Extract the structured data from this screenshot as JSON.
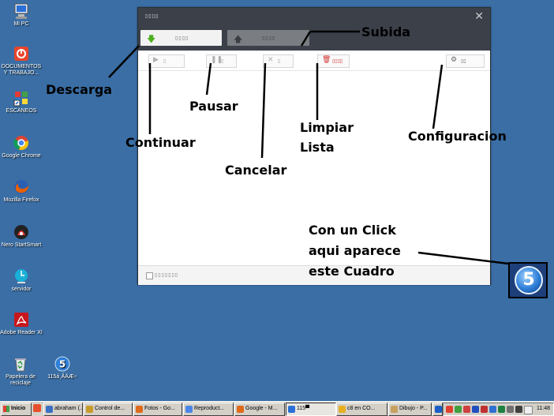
{
  "desktop": {
    "icons": [
      {
        "label": "Mi PC",
        "icon": "my-computer-icon"
      },
      {
        "label": "DOCUMENTOS Y TRABAJO...",
        "icon": "documents-icon"
      },
      {
        "label": "ESCANEOS",
        "icon": "shortcut-icon"
      },
      {
        "label": "Google Chrome",
        "icon": "chrome-icon"
      },
      {
        "label": "Mozilla Firefox",
        "icon": "firefox-icon"
      },
      {
        "label": "Nero StartSmart",
        "icon": "nero-icon"
      },
      {
        "label": "servidor",
        "icon": "server-icon"
      },
      {
        "label": "Adobe Reader XI",
        "icon": "adobe-reader-icon"
      },
      {
        "label": "Papelera de reciclaje",
        "icon": "recycle-bin-icon"
      },
      {
        "label": "115á¸ÂÄÆ÷",
        "icon": "app-115-icon"
      }
    ]
  },
  "app": {
    "title": "▯▯▯▯",
    "close": "✕",
    "tabs": {
      "download": {
        "arrow": "🡇",
        "label": "▯▯▯▯"
      },
      "upload": {
        "arrow": "🡅",
        "label": "▯▯▯▯"
      }
    },
    "toolbar": {
      "continue": {
        "icon": "▶",
        "label": "▯"
      },
      "pause": {
        "icon": "❚❚",
        "label": "▯"
      },
      "cancel": {
        "icon": "✕",
        "label": "▯"
      },
      "clear": {
        "icon": "🗑",
        "label": "▯▯▯▯"
      },
      "settings": {
        "icon": "⚙",
        "label": "▯▯"
      }
    },
    "footer": {
      "checkbox_label": "▯▯▯▯▯▯▯"
    }
  },
  "annotations": {
    "descarga": "Descarga",
    "subida": "Subida",
    "pausar": "Pausar",
    "continuar": "Continuar",
    "cancelar": "Cancelar",
    "limpiar_line1": "Limpiar",
    "limpiar_line2": "Lista",
    "configuracion": "Configuracion",
    "click_line1": "Con un Click",
    "click_line2": "aqui aparece",
    "click_line3": "este Cuadro"
  },
  "floating_icon": {
    "number": "5"
  },
  "taskbar": {
    "start_label": "Inicio",
    "tasks": [
      {
        "label": "abraham (...",
        "color": "#3b6fc4"
      },
      {
        "label": "Control de...",
        "color": "#c89a2a"
      },
      {
        "label": "Fotos - Go...",
        "color": "#e06a1b"
      },
      {
        "label": "Reproduct...",
        "color": "#4a86e8"
      },
      {
        "label": "Google - M...",
        "color": "#e06a1b"
      },
      {
        "label": "115▀",
        "color": "#2a6fd6",
        "active": true
      },
      {
        "label": "c8 en CO...",
        "color": "#e8b020"
      },
      {
        "label": "Dibujo - P...",
        "color": "#c8a060"
      },
      {
        "label": "",
        "color": "#1a5ec8"
      }
    ],
    "clock": "11:48"
  },
  "colors": {
    "desktop": "#3a6ea5",
    "window_chrome": "#3b4049",
    "download_arrow": "#4caf1e",
    "clear_red": "#d32f2f"
  }
}
